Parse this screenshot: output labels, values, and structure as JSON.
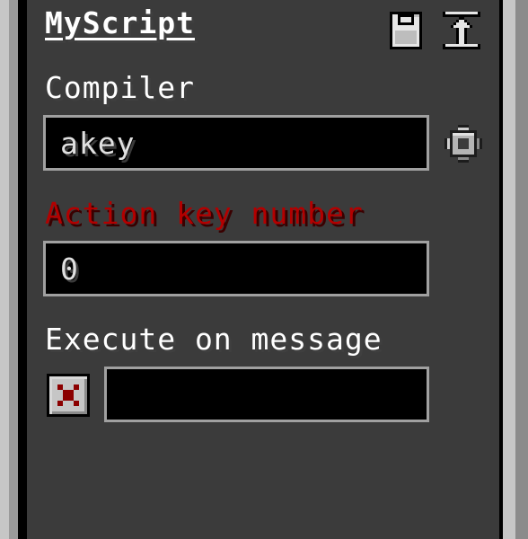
{
  "header": {
    "title": "MyScript"
  },
  "compiler": {
    "label": "Compiler",
    "value": "akey"
  },
  "action_key": {
    "label": "Action key number",
    "value": "0",
    "label_color": "#b30000"
  },
  "execute_on_message": {
    "label": "Execute on message",
    "checked": false,
    "value": ""
  },
  "icons": {
    "save": "floppy-disk-icon",
    "upload": "upload-icon",
    "settings": "gear-icon",
    "checkbox": "checkbox-unchecked-icon"
  }
}
